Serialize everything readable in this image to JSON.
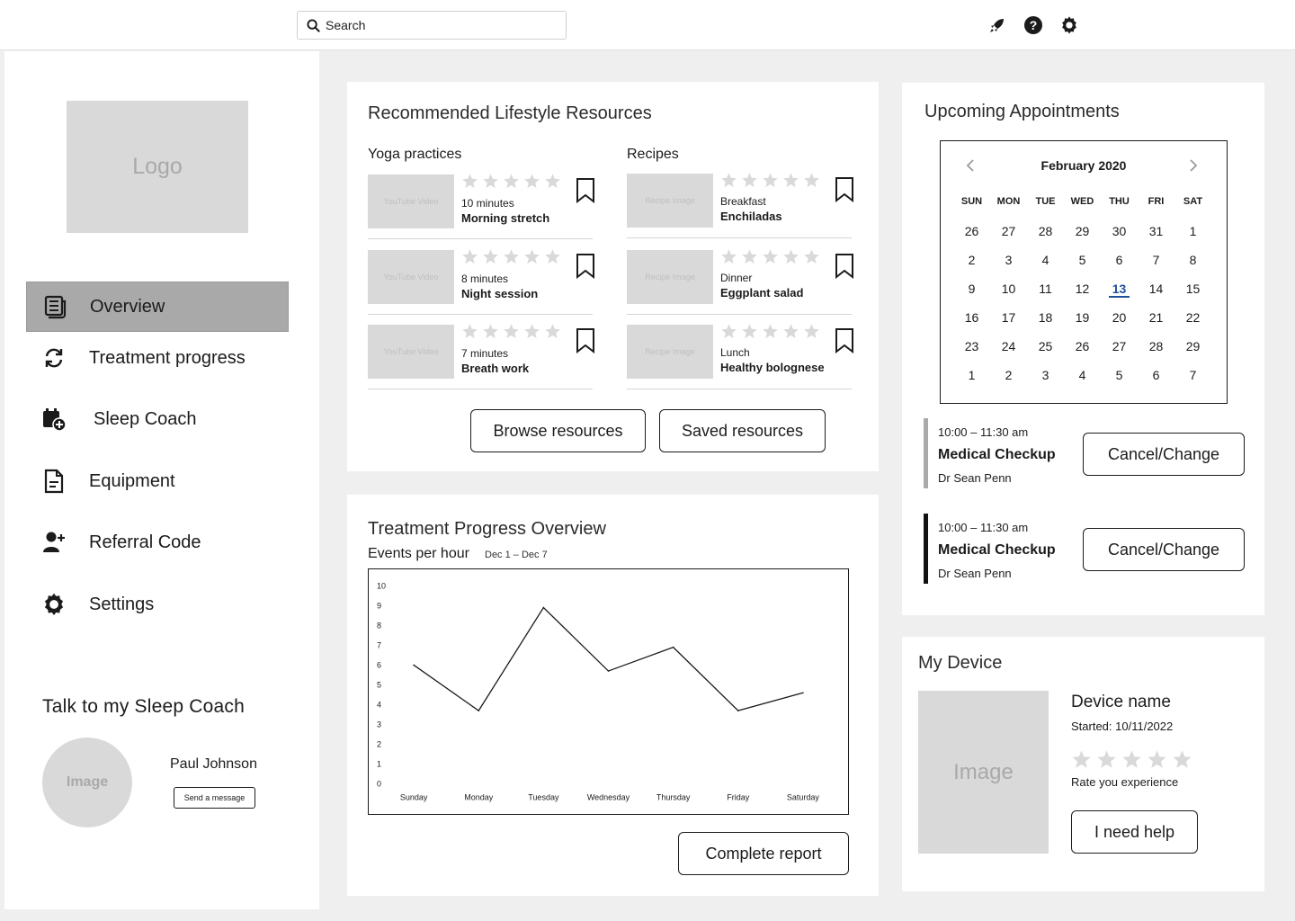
{
  "search": {
    "placeholder": "Search"
  },
  "top_icons": [
    "rocket-icon",
    "help-icon",
    "gear-icon"
  ],
  "sidebar": {
    "logo_text": "Logo",
    "items": [
      {
        "label": "Overview",
        "icon": "newspaper-icon",
        "active": true
      },
      {
        "label": "Treatment progress",
        "icon": "refresh-icon"
      },
      {
        "label": "Sleep Coach",
        "icon": "calendar-add-icon"
      },
      {
        "label": "Equipment",
        "icon": "document-icon"
      },
      {
        "label": "Referral Code",
        "icon": "user-add-icon"
      },
      {
        "label": "Settings",
        "icon": "gear-icon"
      }
    ],
    "coach": {
      "title": "Talk to my Sleep Coach",
      "avatar_text": "Image",
      "name": "Paul Johnson",
      "message_button": "Send a message"
    }
  },
  "resources": {
    "title": "Recommended Lifestyle Resources",
    "yoga": {
      "heading": "Yoga practices",
      "thumb_label": "YouTube Video",
      "items": [
        {
          "meta": "10 minutes",
          "name": "Morning stretch"
        },
        {
          "meta": "8 minutes",
          "name": "Night session"
        },
        {
          "meta": "7 minutes",
          "name": "Breath work"
        }
      ]
    },
    "recipes": {
      "heading": "Recipes",
      "thumb_label": "Recipe Image",
      "items": [
        {
          "meta": "Breakfast",
          "name": "Enchiladas"
        },
        {
          "meta": "Dinner",
          "name": "Eggplant salad"
        },
        {
          "meta": "Lunch",
          "name": "Healthy bolognese"
        }
      ]
    },
    "browse_button": "Browse resources",
    "saved_button": "Saved resources"
  },
  "progress": {
    "title": "Treatment Progress Overview",
    "subtitle": "Events per hour",
    "range": "Dec 1 – Dec 7",
    "report_button": "Complete report"
  },
  "chart_data": {
    "type": "line",
    "title": "Events per hour",
    "subtitle": "Dec 1 – Dec 7",
    "categories": [
      "Sunday",
      "Monday",
      "Tuesday",
      "Wednesday",
      "Thursday",
      "Friday",
      "Saturday"
    ],
    "values": [
      6,
      3.7,
      8.9,
      5.7,
      6.9,
      3.7,
      4.6
    ],
    "yticks": [
      0,
      1,
      2,
      3,
      4,
      5,
      6,
      7,
      8,
      9,
      10
    ],
    "ylim": [
      0,
      10
    ],
    "grid": false,
    "legend": "none",
    "line_color": "#1b1b1b"
  },
  "appointments": {
    "title": "Upcoming Appointments",
    "calendar": {
      "month": "February 2020",
      "weekdays": [
        "SUN",
        "MON",
        "TUE",
        "WED",
        "THU",
        "FRI",
        "SAT"
      ],
      "weeks": [
        [
          "26",
          "27",
          "28",
          "29",
          "30",
          "31",
          "1"
        ],
        [
          "2",
          "3",
          "4",
          "5",
          "6",
          "7",
          "8"
        ],
        [
          "9",
          "10",
          "11",
          "12",
          "13",
          "14",
          "15"
        ],
        [
          "16",
          "17",
          "18",
          "19",
          "20",
          "21",
          "22"
        ],
        [
          "23",
          "24",
          "25",
          "26",
          "27",
          "28",
          "29"
        ],
        [
          "1",
          "2",
          "3",
          "4",
          "5",
          "6",
          "7"
        ]
      ],
      "today": "13",
      "today_color": "#1f4f9a"
    },
    "items": [
      {
        "time": "10:00 – 11:30 am",
        "title": "Medical Checkup",
        "doctor": "Dr Sean Penn",
        "button": "Cancel/Change",
        "bar_color": "#a9a9a9"
      },
      {
        "time": "10:00 – 11:30 am",
        "title": "Medical Checkup",
        "doctor": "Dr Sean Penn",
        "button": "Cancel/Change",
        "bar_color": "#111111"
      }
    ]
  },
  "device": {
    "title": "My Device",
    "image_text": "Image",
    "name": "Device name",
    "started": "Started: 10/11/2022",
    "rating": 0,
    "rating_max": 5,
    "rate_label": "Rate you experience",
    "help_button": "I need help"
  }
}
